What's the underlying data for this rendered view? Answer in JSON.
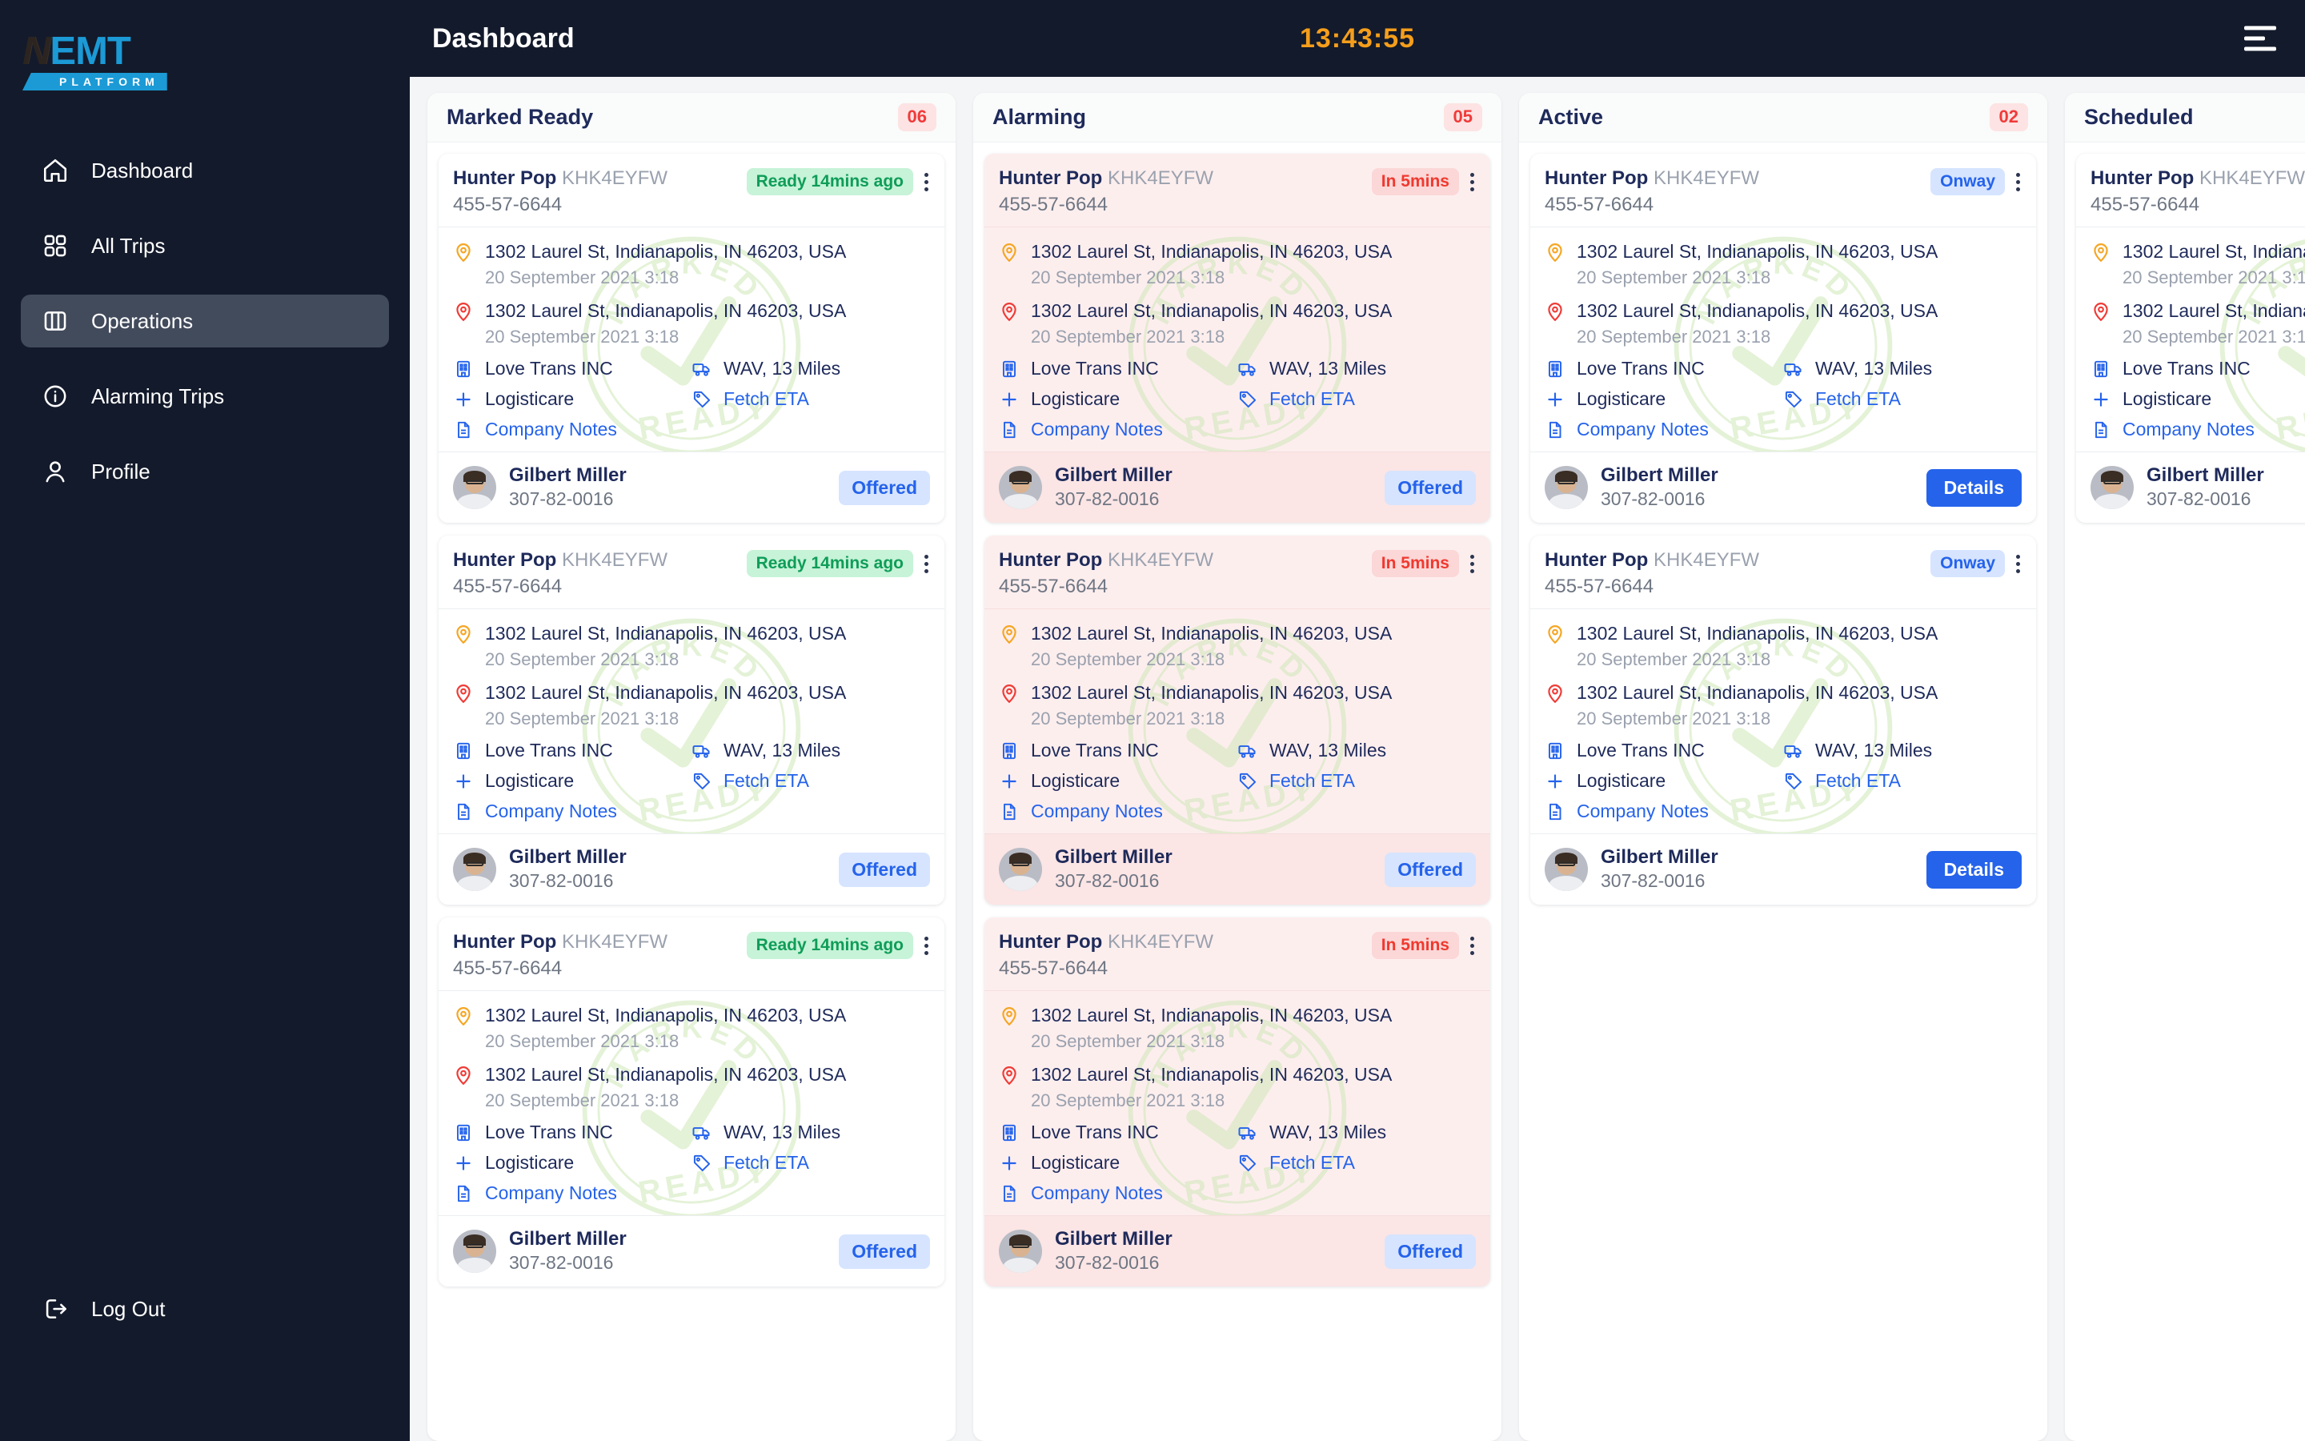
{
  "brand": {
    "mark": "N",
    "emt": "EMT",
    "platform": "PLATFORM"
  },
  "sidebar": {
    "items": [
      {
        "label": "Dashboard",
        "icon": "home-icon",
        "active": false
      },
      {
        "label": "All Trips",
        "icon": "grid-icon",
        "active": false
      },
      {
        "label": "Operations",
        "icon": "columns-icon",
        "active": true
      },
      {
        "label": "Alarming Trips",
        "icon": "info-circle-icon",
        "active": false
      },
      {
        "label": "Profile",
        "icon": "user-icon",
        "active": false
      }
    ],
    "logout": {
      "label": "Log Out",
      "icon": "logout-icon"
    }
  },
  "topbar": {
    "title": "Dashboard",
    "clock": "13:43:55",
    "menu_icon": "hamburger-icon",
    "clock_color": "#f59e1b"
  },
  "trip": {
    "passenger": "Hunter Pop",
    "code": "KHK4EYFW",
    "phone": "455-57-6644",
    "pickup_address": "1302 Laurel St, Indianapolis, IN 46203, USA",
    "pickup_time": "20 September 2021 3:18",
    "dropoff_address": "1302 Laurel St, Indianapolis, IN 46203, USA",
    "dropoff_time": "20 September 2021 3:18",
    "company": "Love Trans INC",
    "vehicle": "WAV, 13 Miles",
    "broker": "Logisticare",
    "eta_link": "Fetch ETA",
    "notes_link": "Company Notes",
    "driver_name": "Gilbert Miller",
    "driver_id": "307-82-0016"
  },
  "badges": {
    "ready": "Ready 14mins ago",
    "alarm": "In 5mins",
    "onway": "Onway",
    "offered": "Offered",
    "details": "Details"
  },
  "columns": [
    {
      "title": "Marked Ready",
      "count": "06",
      "variant": "ready",
      "cards": 3,
      "watermark": "MARKED READY"
    },
    {
      "title": "Alarming",
      "count": "05",
      "variant": "alarm",
      "cards": 3,
      "watermark": "MARKED READY"
    },
    {
      "title": "Active",
      "count": "02",
      "variant": "onway",
      "cards": 2,
      "watermark": "MARKED READY"
    },
    {
      "title": "Scheduled",
      "count": "",
      "variant": "scheduled",
      "cards": 1,
      "watermark": "MARKED READY"
    }
  ],
  "colors": {
    "sidebar_bg": "#131a2b",
    "accent_blue": "#2563eb",
    "badge_red": "#f03a3a",
    "badge_green": "#0f9d58",
    "title_navy": "#1e2a5a",
    "board_bg": "#f4f5f7"
  }
}
